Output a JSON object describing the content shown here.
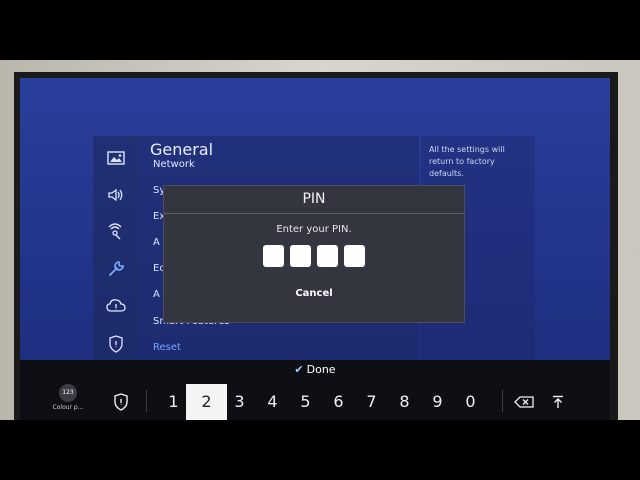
{
  "settings": {
    "title": "General",
    "menu_items": [
      "Network",
      "Sy",
      "Ex",
      "A",
      "Ec",
      "A",
      "Smart Features",
      "Reset"
    ],
    "description": "All the settings will return to factory defaults."
  },
  "sidebar": {
    "icons": [
      "picture-icon",
      "sound-icon",
      "broadcasting-icon",
      "wrench-icon",
      "support-icon",
      "privacy-shield-icon"
    ]
  },
  "pin_dialog": {
    "title": "PIN",
    "prompt": "Enter your PIN.",
    "cancel_label": "Cancel"
  },
  "keyboard": {
    "done_label": "Done",
    "mode_badge": "123",
    "mode_label": "Colour p...",
    "keys": [
      "1",
      "2",
      "3",
      "4",
      "5",
      "6",
      "7",
      "8",
      "9",
      "0"
    ],
    "focused_key": "2"
  },
  "colors": {
    "screen_bg": "#22348a",
    "dialog_bg": "#33363e",
    "reset_accent": "#6ea6ff"
  }
}
